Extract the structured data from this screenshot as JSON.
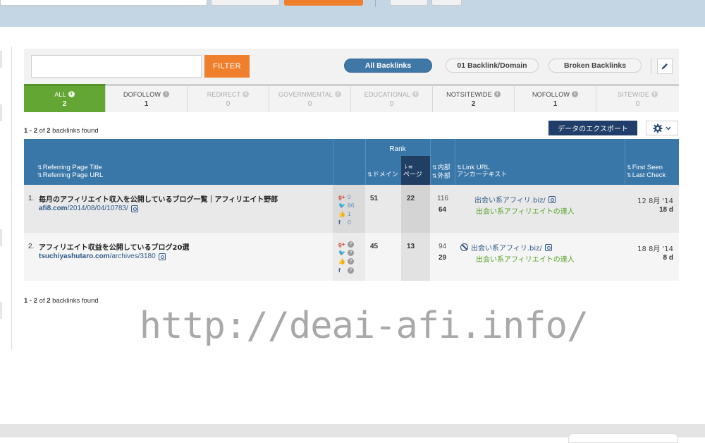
{
  "search": {
    "placeholder": "",
    "filter_label": "FILTER"
  },
  "view_toggles": [
    "All Backlinks",
    "01 Backlink/Domain",
    "Broken Backlinks"
  ],
  "tabs": [
    {
      "label": "ALL",
      "count": "2"
    },
    {
      "label": "DOFOLLOW",
      "count": "1"
    },
    {
      "label": "REDIRECT",
      "count": "0"
    },
    {
      "label": "GOVERNMENTAL",
      "count": "0"
    },
    {
      "label": "EDUCATIONAL",
      "count": "0"
    },
    {
      "label": "NOTSITEWIDE",
      "count": "2"
    },
    {
      "label": "NOFOLLOW",
      "count": "1"
    },
    {
      "label": "SITEWIDE",
      "count": "0"
    }
  ],
  "results": {
    "range": "1 - 2",
    "of": "of",
    "total": "2",
    "suffix": "backlinks found"
  },
  "export_label": "データのエクスポート",
  "columns": {
    "title_1": "Referring Page Title",
    "title_2": "Referring Page URL",
    "rank": "Rank",
    "domain": "ドメイン",
    "page": "ページ",
    "internal": "内部",
    "external": "外部",
    "link_url": "Link URL",
    "anchor": "アンカーテキスト",
    "first_seen": "First Seen",
    "last_check": "Last Check"
  },
  "rows": [
    {
      "num": "1.",
      "title": "毎月のアフィリエイト収入を公開しているブログ一覧｜アフィリエイト野郎",
      "url_domain": "afi8.com",
      "url_path": "/2014/08/04/10783/",
      "gplus": "0",
      "twitter": "86",
      "like": "1",
      "facebook": "0",
      "rank_domain": "51",
      "rank_page": "22",
      "internal": "116",
      "external": "64",
      "link_url": "出会い系アフィリ.biz/",
      "anchor": "出会い系アフィリエイトの達人",
      "first_seen": "12 8月 '14",
      "last_check": "18 d"
    },
    {
      "num": "2.",
      "title": "アフィリエイト収益を公開しているブログ20選",
      "url_domain": "tsuchiyashutaro.com",
      "url_path": "/archives/3180",
      "gplus": "?",
      "twitter": "?",
      "like": "?",
      "facebook": "?",
      "rank_domain": "45",
      "rank_page": "13",
      "internal": "94",
      "external": "29",
      "link_url": "出会い系アフィリ.biz/",
      "anchor": "出会い系アフィリエイトの達人",
      "first_seen": "18 8月 '14",
      "last_check": "8 d"
    }
  ],
  "watermark": "http://deai-afi.info/",
  "colors": {
    "accent_orange": "#f07f2d",
    "header_blue": "#3a77a9",
    "active_green": "#64a633",
    "navy": "#1f3f6a"
  }
}
